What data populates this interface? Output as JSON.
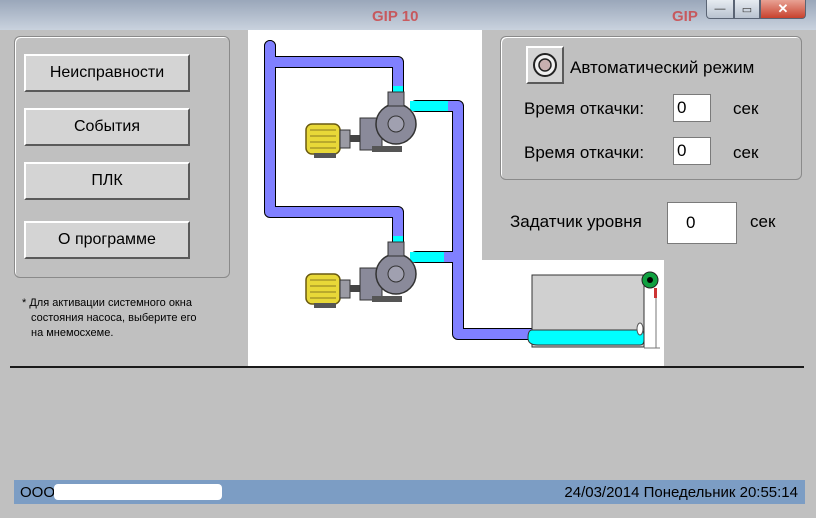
{
  "titlebar": {
    "background_labels": [
      "GIP 10",
      "GIP"
    ],
    "min_glyph": "—",
    "max_glyph": "▭",
    "close_glyph": "✕"
  },
  "left_menu": {
    "buttons": [
      {
        "label": "Неисправности"
      },
      {
        "label": "События"
      },
      {
        "label": "ПЛК"
      },
      {
        "label": "О программе"
      }
    ]
  },
  "hint": {
    "line1": "* Для активации системного окна",
    "line2": "состояния насоса, выберите его",
    "line3": "на мнемосхеме."
  },
  "auto_panel": {
    "title": "Автоматический режим",
    "rows": [
      {
        "label": "Время откачки:",
        "value": "0",
        "unit": "сек"
      },
      {
        "label": "Время откачки:",
        "value": "0",
        "unit": "сек"
      }
    ]
  },
  "level_setter": {
    "label": "Задатчик уровня",
    "value": "0",
    "unit": "сек"
  },
  "status_bar": {
    "company": "ООО",
    "datetime": "24/03/2014 Понедельник 20:55:14"
  },
  "colors": {
    "pipe": "#8080ff",
    "water": "#00ffff",
    "motor": "#e8d838",
    "status_bar": "#7c9dc4",
    "sensor_green": "#10a040"
  },
  "icons": [
    "minimize-icon",
    "maximize-icon",
    "close-icon",
    "auto-mode-icon",
    "pump-icon",
    "motor-icon",
    "level-sensor-icon"
  ]
}
